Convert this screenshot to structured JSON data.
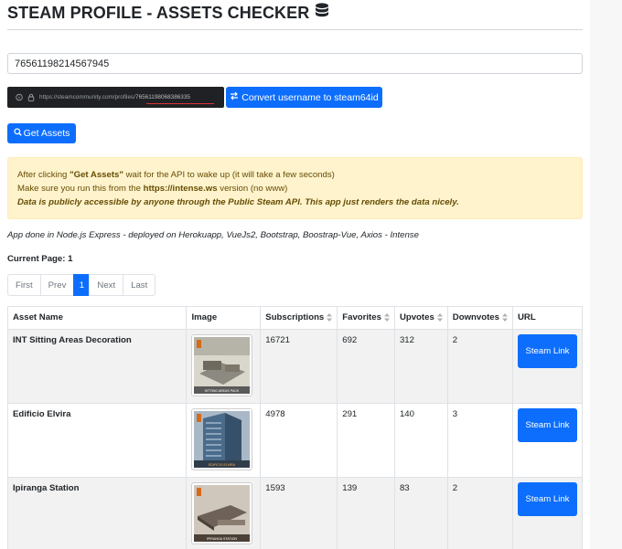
{
  "header": {
    "title": "STEAM PROFILE - ASSETS CHECKER",
    "title_icon": "database-icon"
  },
  "steamid_input": {
    "value": "76561198214567945"
  },
  "browser_hint": {
    "url_prefix": "https://steamcommunity.com/profiles/",
    "url_id": "76561198068386335"
  },
  "convert_button": {
    "icon": "exchange-arrows-icon",
    "label": "Convert username to steam64id"
  },
  "get_button": {
    "icon": "search-icon",
    "label": "Get Assets"
  },
  "alert": {
    "line1_pre": "After clicking ",
    "line1_bold": "\"Get Assets\"",
    "line1_post": " wait for the API to wake up (it will take a few seconds)",
    "line2_pre": "Make sure you run this from the ",
    "line2_bold": "https://intense.ws",
    "line2_post": " version (no www)",
    "line3": "Data is publicly accessible by anyone through the Public Steam API. This app just renders the data nicely."
  },
  "credits": "App done in Node.js Express - deployed on Herokuapp, VueJs2, Bootstrap, Boostrap-Vue, Axios - Intense",
  "current_page": "Current Page: 1",
  "pagination": {
    "first": "First",
    "prev": "Prev",
    "current": "1",
    "next": "Next",
    "last": "Last"
  },
  "table": {
    "headers": {
      "name": "Asset Name",
      "image": "Image",
      "subscriptions": "Subscriptions",
      "favorites": "Favorites",
      "upvotes": "Upvotes",
      "downvotes": "Downvotes",
      "url": "URL"
    },
    "rows": [
      {
        "name": "INT Sitting Areas Decoration",
        "subscriptions": "16721",
        "favorites": "692",
        "upvotes": "312",
        "downvotes": "2",
        "url_label": "Steam Link",
        "thumb_caption": "SITTING AREAS PACK",
        "thumb_color": "#8c8a80"
      },
      {
        "name": "Edificio Elvira",
        "subscriptions": "4978",
        "favorites": "291",
        "upvotes": "140",
        "downvotes": "3",
        "url_label": "Steam Link",
        "thumb_caption": "EDIFICIO ELVIRA",
        "thumb_color": "#4a6b8a"
      },
      {
        "name": "Ipiranga Station",
        "subscriptions": "1593",
        "favorites": "139",
        "upvotes": "83",
        "downvotes": "2",
        "url_label": "Steam Link",
        "thumb_caption": "IPIRANGA STATION",
        "thumb_color": "#6e6258"
      }
    ]
  }
}
